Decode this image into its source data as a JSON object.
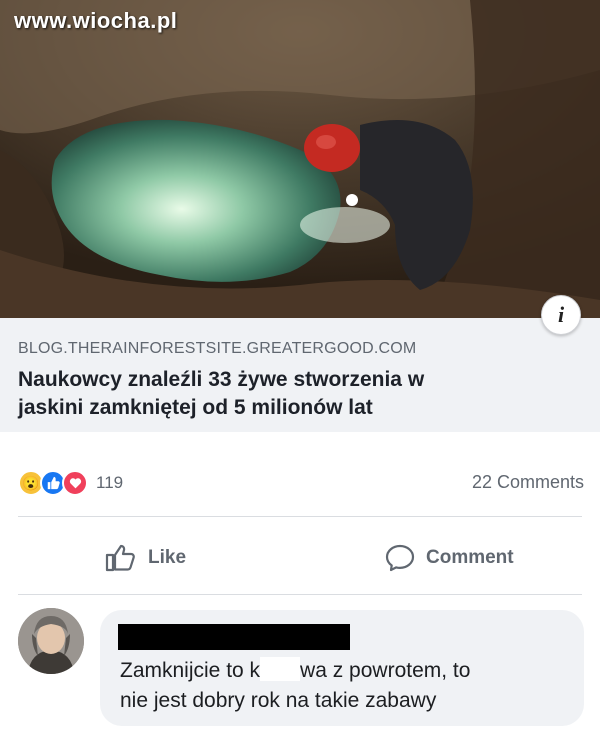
{
  "watermark": "www.wiocha.pl",
  "link_preview": {
    "domain": "BLOG.THERAINFORESTSITE.GREATERGOOD.COM",
    "title_line1": "Naukowcy znaleźli 33 żywe stworzenia w",
    "title_line2": "jaskini zamkniętej od 5 milionów lat",
    "info_icon": "i"
  },
  "reactions": {
    "icons": [
      "wow-reaction-icon",
      "like-reaction-icon",
      "love-reaction-icon"
    ],
    "count": "119",
    "comments": "22 Comments"
  },
  "actions": {
    "like_label": "Like",
    "comment_label": "Comment"
  },
  "comment": {
    "text_part1": "Zamknijcie to k",
    "text_part2": "wa z powrotem, to",
    "text_line2": "nie jest dobry rok na takie zabawy"
  },
  "colors": {
    "link_box_bg": "#f0f2f5",
    "muted_text": "#606770",
    "like_blue": "#1877f2",
    "love_red": "#f0405b",
    "wow_yellow": "#f7c23a"
  }
}
